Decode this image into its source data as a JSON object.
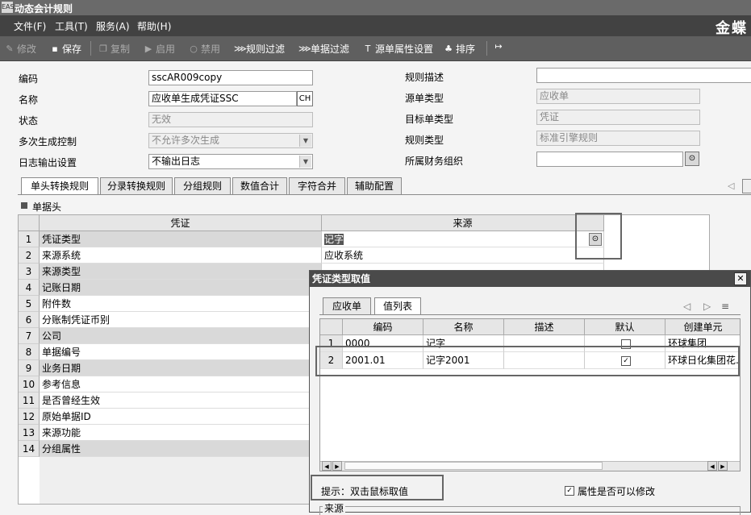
{
  "window": {
    "title": "动态会计规则",
    "app_icon": "EAS",
    "brand": "金蝶"
  },
  "menu": [
    "文件(F)",
    "工具(T)",
    "服务(A)",
    "帮助(H)"
  ],
  "toolbar": {
    "edit": "修改",
    "save": "保存",
    "copy": "复制",
    "enable": "启用",
    "disable": "禁用",
    "rule_filter": "规则过滤",
    "bill_filter": "单据过滤",
    "src_attr": "源单属性设置",
    "sort": "排序"
  },
  "form": {
    "code_label": "编码",
    "code_value": "sscAR009copy",
    "name_label": "名称",
    "name_value": "应收单生成凭证SSC",
    "name_lang_btn": "CH",
    "status_label": "状态",
    "status_value": "无效",
    "multi_label": "多次生成控制",
    "multi_value": "不允许多次生成",
    "log_label": "日志输出设置",
    "log_value": "不输出日志",
    "desc_label": "规则描述",
    "desc_value": "",
    "src_type_label": "源单类型",
    "src_type_value": "应收单",
    "tgt_type_label": "目标单类型",
    "tgt_type_value": "凭证",
    "rule_type_label": "规则类型",
    "rule_type_value": "标准引擎规则",
    "org_label": "所属财务组织",
    "org_value": ""
  },
  "tabs": [
    "单头转换规则",
    "分录转换规则",
    "分组规则",
    "数值合计",
    "字符合并",
    "辅助配置"
  ],
  "section_label": "单据头",
  "grid": {
    "col_voucher": "凭证",
    "col_source": "来源",
    "rows": [
      {
        "n": "1",
        "voucher": "凭证类型",
        "source": "记字"
      },
      {
        "n": "2",
        "voucher": "来源系统",
        "source": "应收系统"
      },
      {
        "n": "3",
        "voucher": "来源类型",
        "source": ""
      },
      {
        "n": "4",
        "voucher": "记账日期",
        "source": ""
      },
      {
        "n": "5",
        "voucher": "附件数",
        "source": ""
      },
      {
        "n": "6",
        "voucher": "分账制凭证币别",
        "source": ""
      },
      {
        "n": "7",
        "voucher": "公司",
        "source": ""
      },
      {
        "n": "8",
        "voucher": "单据编号",
        "source": ""
      },
      {
        "n": "9",
        "voucher": "业务日期",
        "source": ""
      },
      {
        "n": "10",
        "voucher": "参考信息",
        "source": ""
      },
      {
        "n": "11",
        "voucher": "是否曾经生效",
        "source": ""
      },
      {
        "n": "12",
        "voucher": "原始单据ID",
        "source": ""
      },
      {
        "n": "13",
        "voucher": "来源功能",
        "source": ""
      },
      {
        "n": "14",
        "voucher": "分组属性",
        "source": ""
      }
    ]
  },
  "dialog": {
    "title": "凭证类型取值",
    "tabs": [
      "应收单",
      "值列表"
    ],
    "cols": [
      "编码",
      "名称",
      "描述",
      "默认",
      "创建单元"
    ],
    "rows": [
      {
        "n": "1",
        "code": "0000",
        "name": "记字",
        "desc": "",
        "default": false,
        "unit": "环球集团"
      },
      {
        "n": "2",
        "code": "2001.01",
        "name": "记字2001",
        "desc": "",
        "default": true,
        "unit": "环球日化集团花."
      }
    ],
    "hint": "提示：双击鼠标取值",
    "editable_label": "属性是否可以修改",
    "editable_checked": true,
    "source_group": "来源"
  }
}
